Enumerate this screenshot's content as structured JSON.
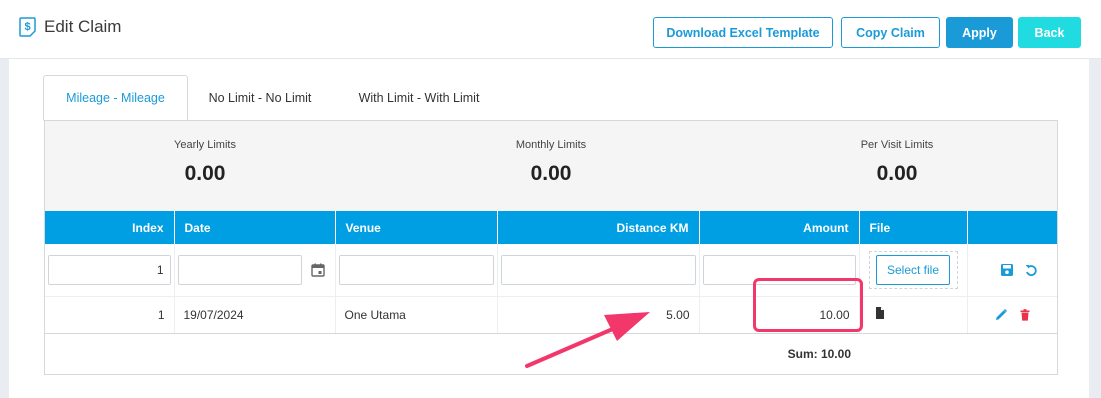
{
  "header": {
    "title": "Edit Claim",
    "buttons": {
      "download_template": "Download Excel Template",
      "copy_claim": "Copy Claim",
      "apply": "Apply",
      "back": "Back"
    }
  },
  "tabs": [
    {
      "label": "Mileage - Mileage",
      "active": true
    },
    {
      "label": "No Limit - No Limit",
      "active": false
    },
    {
      "label": "With Limit - With Limit",
      "active": false
    }
  ],
  "limits": {
    "yearly": {
      "label": "Yearly Limits",
      "value": "0.00"
    },
    "monthly": {
      "label": "Monthly Limits",
      "value": "0.00"
    },
    "per_visit": {
      "label": "Per Visit Limits",
      "value": "0.00"
    }
  },
  "table": {
    "columns": [
      "Index",
      "Date",
      "Venue",
      "Distance KM",
      "Amount",
      "File",
      ""
    ],
    "input_row": {
      "index": "1",
      "date": "",
      "venue": "",
      "distance": "",
      "amount": "",
      "select_file_label": "Select file"
    },
    "rows": [
      {
        "index": "1",
        "date": "19/07/2024",
        "venue": "One Utama",
        "distance": "5.00",
        "amount": "10.00"
      }
    ],
    "sum": "Sum: 10.00"
  },
  "colors": {
    "primary": "#1a9bd7",
    "header_bg": "#009fe3",
    "back_button": "#20dbe0",
    "annotation": "#f2386a",
    "delete_icon": "#e8334a"
  },
  "icons": {
    "title": "dollar-document-icon",
    "date": "calendar-icon",
    "save": "save-icon",
    "undo": "undo-icon",
    "file": "file-icon",
    "edit": "pencil-icon",
    "delete": "trash-icon"
  }
}
